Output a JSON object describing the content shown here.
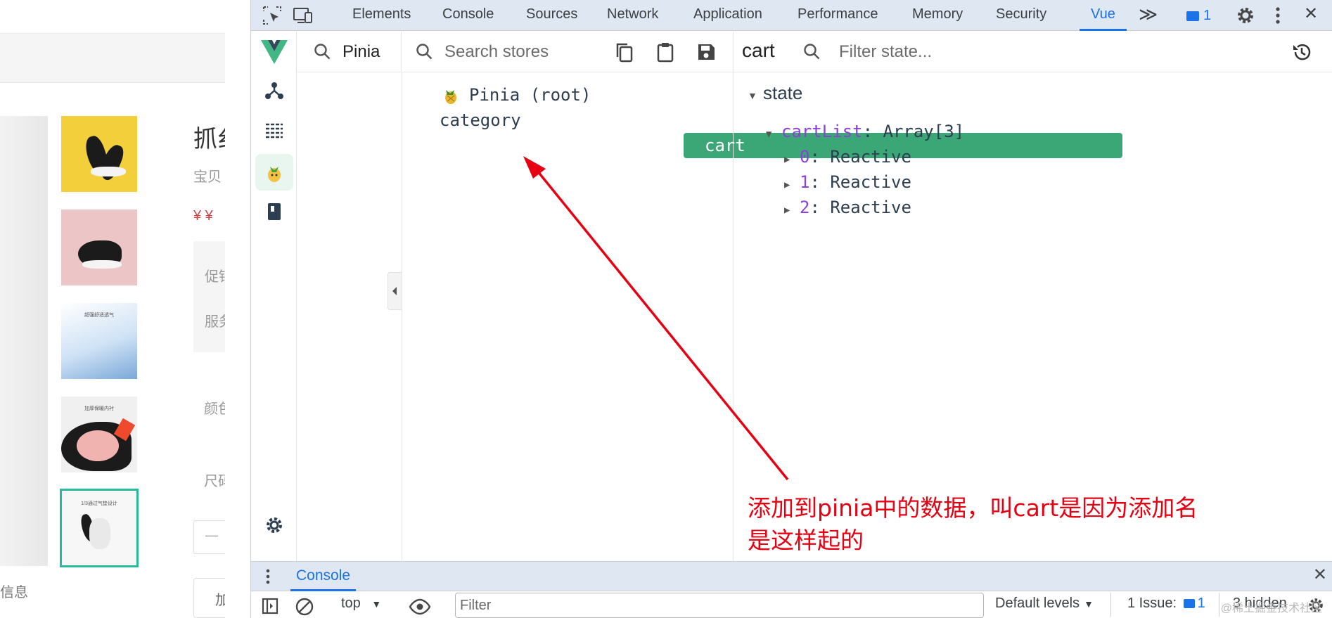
{
  "webpage": {
    "title_char": "抓纟",
    "subtitle_chars": "宝贝",
    "price_chars": "¥ ¥",
    "promo_label": "促铂",
    "service_label": "服务",
    "color_label": "颜色",
    "size_label": "尺码",
    "stepper_minus": "—",
    "add_button_char": "加",
    "left_info": "信息",
    "thumb_blue_text": "超强舒适透气",
    "thumb_white_text": "加厚保暖内衬",
    "thumb_last_text": "1/3通过气垫设计"
  },
  "devtools": {
    "tabs": [
      "Elements",
      "Console",
      "Sources",
      "Network",
      "Application",
      "Performance",
      "Memory",
      "Security",
      "Vue"
    ],
    "active_tab": "Vue",
    "more_tabs_glyph": "≫",
    "issues_count": "1",
    "close_glyph": "✕"
  },
  "vue": {
    "plugin_search_value": "Pinia",
    "stores_search_placeholder": "Search stores",
    "stores": [
      {
        "label": "Pinia (root)",
        "icon": "pineapple-icon"
      },
      {
        "label": "category"
      },
      {
        "label": "cart",
        "selected": true
      }
    ],
    "inspected_store": "cart",
    "state_filter_placeholder": "Filter state...",
    "state_section": "state",
    "state_tree": {
      "key": "cartList",
      "type": "Array[3]",
      "children": [
        {
          "key": "0",
          "value": "Reactive"
        },
        {
          "key": "1",
          "value": "Reactive"
        },
        {
          "key": "2",
          "value": "Reactive"
        }
      ]
    }
  },
  "drawer": {
    "tab_label": "Console",
    "context": "top",
    "filter_placeholder": "Filter",
    "levels_label": "Default levels",
    "issues_label": "1 Issue:",
    "issues_count": "1",
    "hidden_label": "3 hidden"
  },
  "annotation": {
    "line1": "添加到pinia中的数据，叫cart是因为添加名",
    "line2": "是这样起的",
    "color": "#e60012"
  },
  "watermark": "@稀土掘金技术社区",
  "colors": {
    "vue_green": "#3ba776",
    "tab_bar": "#dfe7f3",
    "accent_blue": "#1a73e8"
  }
}
